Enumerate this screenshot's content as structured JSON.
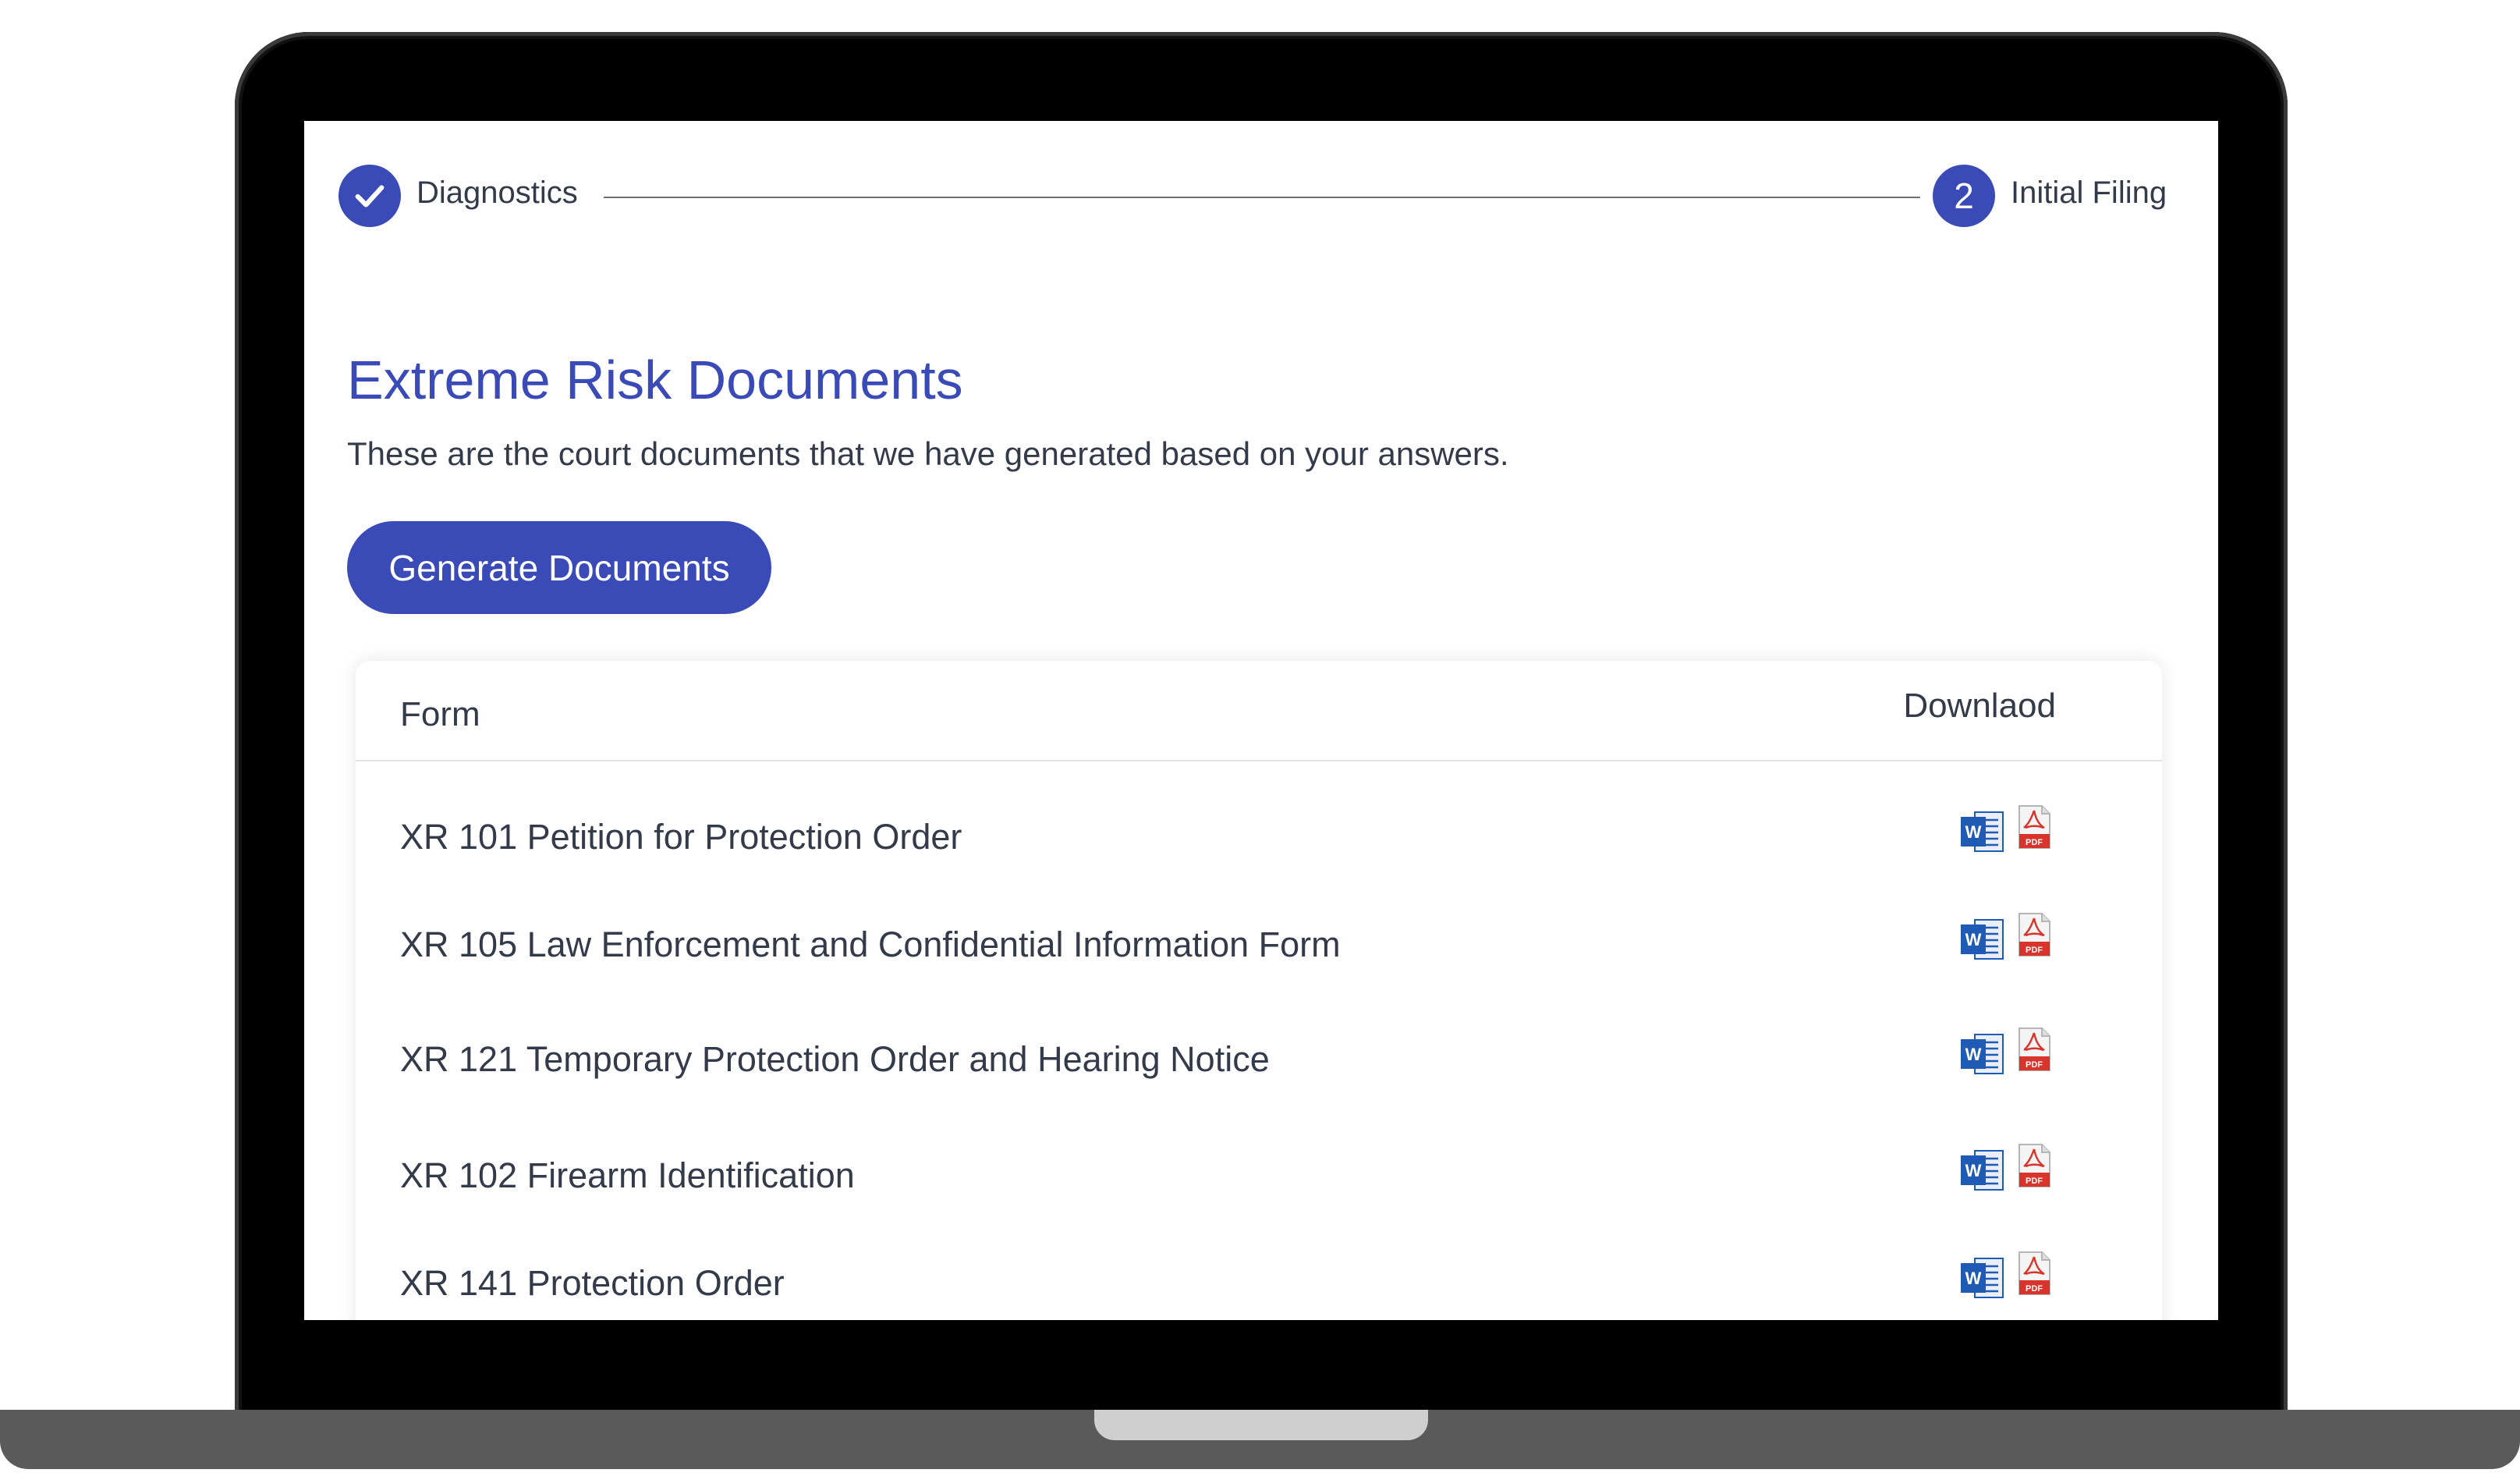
{
  "stepper": {
    "step1": {
      "label": "Diagnostics",
      "status": "complete",
      "icon": "checkmark-icon"
    },
    "step2": {
      "number": "2",
      "label": "Initial Filing",
      "status": "current"
    }
  },
  "page": {
    "title": "Extreme Risk Documents",
    "subtitle": "These are the court documents that we have generated based on your answers."
  },
  "actions": {
    "generate_label": "Generate Documents"
  },
  "table": {
    "headers": {
      "form": "Form",
      "download": "Downlaod"
    },
    "rows": [
      {
        "name": "XR 101 Petition for Protection Order"
      },
      {
        "name": "XR 105 Law Enforcement and Confidential Information Form"
      },
      {
        "name": "XR 121 Temporary Protection Order and Hearing Notice"
      },
      {
        "name": "XR 102 Firearm Identification"
      },
      {
        "name": "XR 141 Protection Order"
      }
    ],
    "download_icons": [
      "word-document-icon",
      "pdf-document-icon"
    ]
  },
  "colors": {
    "accent": "#3a4ab7",
    "text": "#333a4a",
    "word_blue": "#1f5bb5",
    "pdf_red": "#d9342b"
  }
}
